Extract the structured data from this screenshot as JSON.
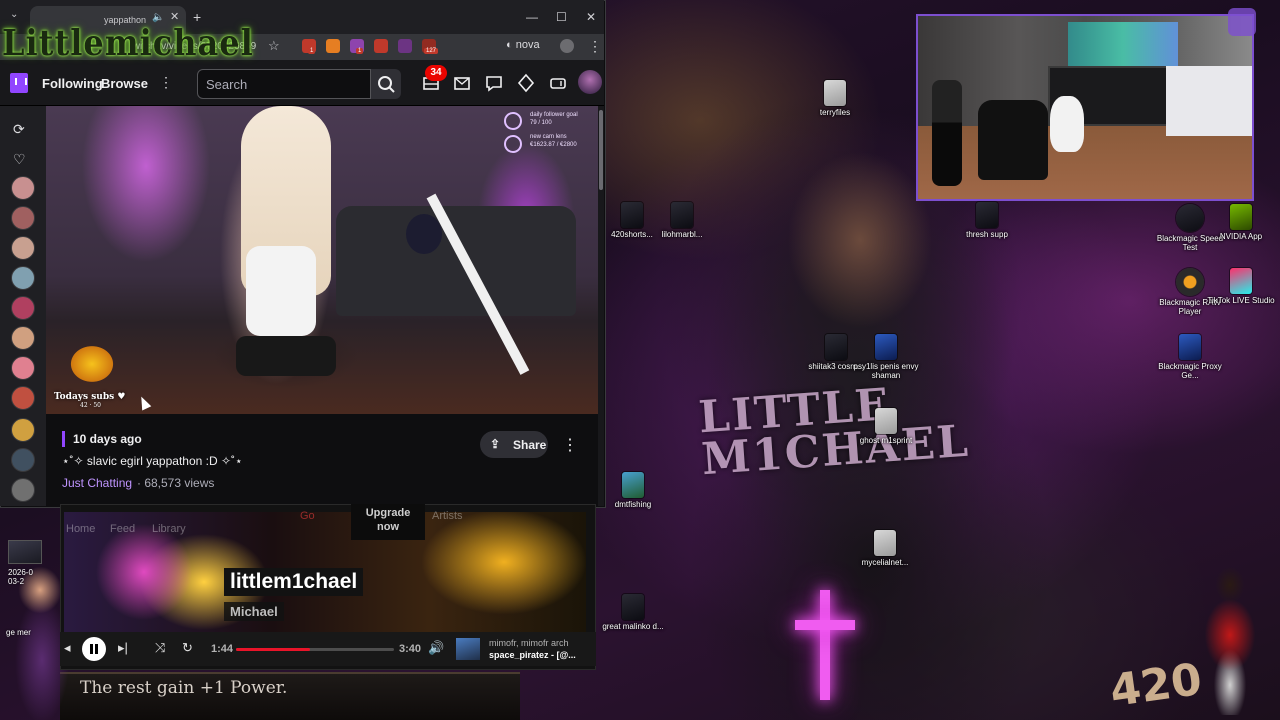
{
  "channel_logo": "Littlemichael",
  "browser": {
    "tab_title": "yappathon",
    "url": "twitch.tv/videos/2720426869",
    "extensions": [
      {
        "name": "ext-1",
        "badge": "1",
        "color": "#c0392b"
      },
      {
        "name": "ext-2",
        "badge": "",
        "color": "#e67e22"
      },
      {
        "name": "ext-3",
        "badge": "1",
        "color": "#8e44ad"
      },
      {
        "name": "ext-4",
        "badge": "",
        "color": "#c0392b"
      },
      {
        "name": "ext-5",
        "badge": "",
        "color": "#6c3483"
      },
      {
        "name": "ext-6",
        "badge": "127",
        "color": "#922b21"
      },
      {
        "name": "ext-7",
        "badge": "",
        "color": "#5d6d7e"
      }
    ],
    "profile_ext": "nova"
  },
  "twitch": {
    "nav": {
      "following": "Following",
      "browse": "Browse",
      "search_placeholder": "Search",
      "notification_count": "34"
    },
    "video": {
      "follower_goal_title": "daily follower goal",
      "follower_goal_progress": "79 / 100",
      "cam_lens_title": "new cam lens",
      "cam_lens_progress": "€1623.87 / €2800",
      "subs_title": "Todays subs",
      "subs_progress": "42 · 50"
    },
    "info": {
      "age": "10 days ago",
      "title": "⋆˚✧ slavic egirl yappathon :D ✧˚⋆",
      "category": "Just Chatting",
      "views": "· 68,573 views",
      "share_label": "Share"
    }
  },
  "music": {
    "ghost_nav": [
      "Home",
      "Feed",
      "Library",
      "Go",
      "Artists"
    ],
    "upgrade_label_1": "Upgrade",
    "upgrade_label_2": "now",
    "artist_name": "littlem1chael",
    "artist_sub": "Michael",
    "elapsed": "1:44",
    "duration": "3:40",
    "progress_fraction": 0.47,
    "now_playing_artists": "mimofr, mimofr arch",
    "now_playing_track": "space_piratez - [@...",
    "accent_color": "#e91429"
  },
  "desktop": {
    "icons": [
      {
        "label": "terryfiles",
        "glyph": "g-doc"
      },
      {
        "label": "420shorts...",
        "glyph": "g-dark"
      },
      {
        "label": "lilohmarbl...",
        "glyph": "g-dark"
      },
      {
        "label": "thresh supp",
        "glyph": "g-dark"
      },
      {
        "label": "Blackmagic Speed Test",
        "glyph": "g-dark"
      },
      {
        "label": "NVIDIA App",
        "glyph": "g-green"
      },
      {
        "label": "Blackmagic RAW Player",
        "glyph": "g-bm"
      },
      {
        "label": "TikTok LIVE Studio",
        "glyph": "g-tiktok"
      },
      {
        "label": "Blackmagic Proxy Ge...",
        "glyph": "g-blue"
      },
      {
        "label": "shiitak3 cosm...",
        "glyph": "g-dark"
      },
      {
        "label": "psy1lis penis envy shaman",
        "glyph": "g-blue"
      },
      {
        "label": "ghost m1sprint",
        "glyph": "g-doc"
      },
      {
        "label": "dmtfishing",
        "glyph": "g-land"
      },
      {
        "label": "mycelialnet...",
        "glyph": "g-doc"
      },
      {
        "label": "great malinko d...",
        "glyph": "g-dark"
      }
    ],
    "wallpaper_title_1": "LITTLE",
    "wallpaper_title_2": "M1CHAEL",
    "wallpaper_number": "420",
    "card_text": "The rest gain +1 Power.",
    "left_clock_1": "2026-0",
    "left_clock_2": "03-2",
    "left_label": "ge mer"
  }
}
